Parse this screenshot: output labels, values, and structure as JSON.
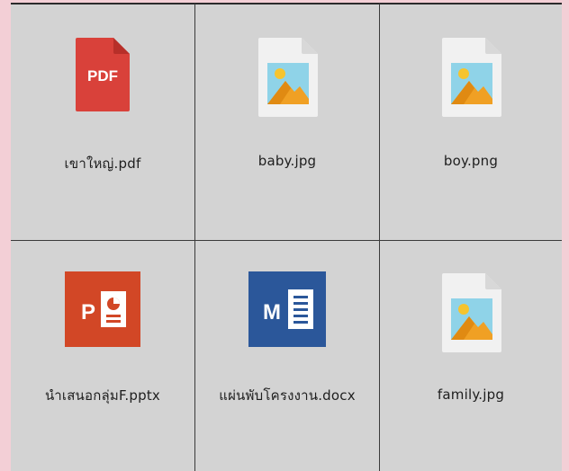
{
  "files": [
    {
      "name": "เขาใหญ่.pdf",
      "icon": "pdf-icon",
      "pdf_text": "PDF"
    },
    {
      "name": "baby.jpg",
      "icon": "image-file-icon"
    },
    {
      "name": "boy.png",
      "icon": "image-file-icon"
    },
    {
      "name": "นำเสนอกลุ่มF.pptx",
      "icon": "powerpoint-icon",
      "letter": "P"
    },
    {
      "name": "แผ่นพับโครงงาน.docx",
      "icon": "word-icon",
      "letter": "M"
    },
    {
      "name": "family.jpg",
      "icon": "image-file-icon"
    }
  ],
  "colors": {
    "background": "#f3cfd6",
    "grid": "#d3d3d3",
    "pdf_red": "#d9413a",
    "ppt_orange": "#d24726",
    "word_blue": "#2b579a",
    "image_sky": "#8fd3e8",
    "image_mountain": "#f0a024",
    "image_sun": "#f6c42e"
  }
}
